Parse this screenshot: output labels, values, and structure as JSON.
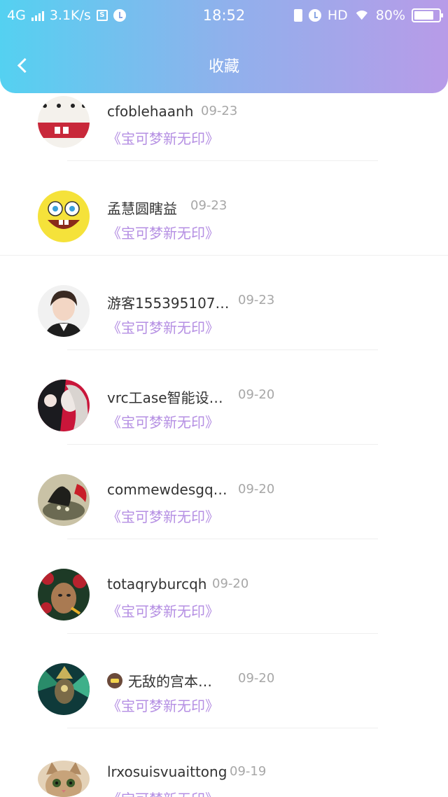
{
  "status_bar": {
    "network": "4G",
    "speed": "3.1K/s",
    "sim_icon": "S",
    "time": "18:52",
    "hd": "HD",
    "battery_percent": "80%",
    "battery_level": 0.8
  },
  "nav": {
    "title": "收藏",
    "back_icon": "chevron-left-icon"
  },
  "items": [
    {
      "name": "cfoblehaanh",
      "date": "09-23",
      "book": "《宝可梦新无印》"
    },
    {
      "name": "孟慧圆瞎益",
      "date": "09-23",
      "book": "《宝可梦新无印》"
    },
    {
      "name": "游客155395107…",
      "date": "09-23",
      "book": "《宝可梦新无印》"
    },
    {
      "name": "vrc工ase智能设…",
      "date": "09-20",
      "book": "《宝可梦新无印》"
    },
    {
      "name": "commewdesgq…",
      "date": "09-20",
      "book": "《宝可梦新无印》"
    },
    {
      "name": "totaqryburcqh",
      "date": "09-20",
      "book": "《宝可梦新无印》"
    },
    {
      "name": "无敌的宫本…",
      "date": "09-20",
      "book": "《宝可梦新无印》"
    },
    {
      "name": "lrxosuisvuaittong",
      "date": "09-19",
      "book": "《宝可梦新无印》"
    }
  ]
}
